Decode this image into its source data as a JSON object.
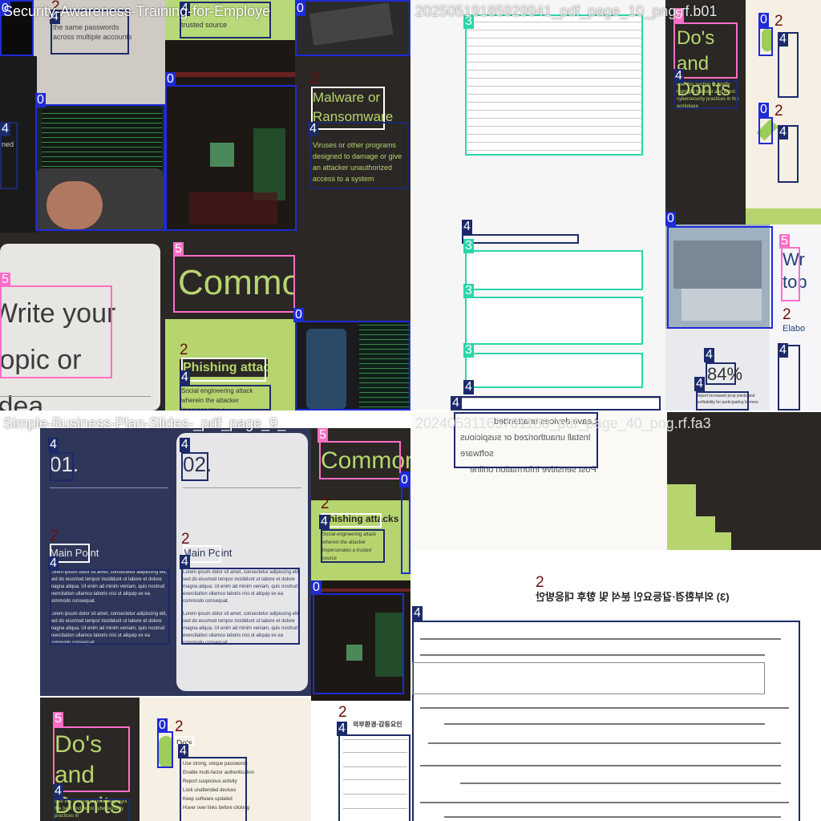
{
  "quadrants": [
    {
      "title": "Security-Awareness-Training-for-Employe",
      "texts": {
        "passwords": "the same passwords across multiple accounts",
        "trusted": "trusted source",
        "malware_title": "Malware or Ransomware",
        "malware_body": "Viruses or other programs designed to damage or give an attacker unauthorized access to a system",
        "write_topic": "Write your topic or idea",
        "common": "Common",
        "phishing_title": "Phishing attacks",
        "phishing_body": "Social engineering attack wherein the attacker impersonates a",
        "ned": "ned"
      }
    },
    {
      "title": "20250519185929941_pdf_page_10_png.rf.b01",
      "texts": {
        "dos_donts": "Do's and Don'ts",
        "dos_body": "Use this section to briefly highlight the best and worst cybersecurity practices in the workplace",
        "percent": "84%",
        "report": "Report increased prop yields and profitability for participating farmers",
        "write_short": "Wr top",
        "elab": "Elabo"
      }
    },
    {
      "title": "Simple-Business-Plan-Slides-_pdf_page_9_",
      "texts": {
        "num1": "01.",
        "num2": "02.",
        "main_point_1": "Main Point",
        "main_point_2": "Main Point",
        "lorem": "Lorem ipsum dolor sit amet, consectetur adipiscing elit, sed do eiusmod tempor incididunt ut labore et dolore magna aliqua. Ut enim ad minim veniam, quis nostrud exercitation ullamco laboris nisi ut aliquip ex ea commodo consequat.",
        "common": "Common",
        "phishing_title": "Phishing attacks",
        "phishing_body": "Social engineering attack wherein the attacker impersonates a trusted source",
        "dos_donts": "Do's and Don'ts",
        "dos_body": "Use this section to briefly highlight the best and worst cybersecurity practices in",
        "dos_short": "Do's",
        "list_items": [
          "Use strong, unique passwords",
          "Enable multi-factor authentication",
          "Report suspicious activity",
          "Lock unattended devices",
          "Keep software updated",
          "Hover over links before clicking"
        ],
        "korean_heading": "외부환경·감등요인"
      }
    },
    {
      "title": "20240531165701180_pdf_page_40_png.rf.fa3",
      "texts": {
        "mirror_lines": [
          "Leave devices unattended",
          "Install unauthorized or suspicious software",
          "Post sensitive information online"
        ],
        "korean_heading": "(3) 외부환경·갈등요인 분석 및 향후 대응방안"
      }
    }
  ],
  "annotation_labels": {
    "c0": "0",
    "c2": "2",
    "c3": "3",
    "c4": "4",
    "c5": "5"
  },
  "colors": {
    "class0": "#1f2bd6",
    "class2": "#6b1010",
    "class3": "#2bd6a8",
    "class4": "#1c2a6b",
    "class5": "#ff6ec7"
  }
}
